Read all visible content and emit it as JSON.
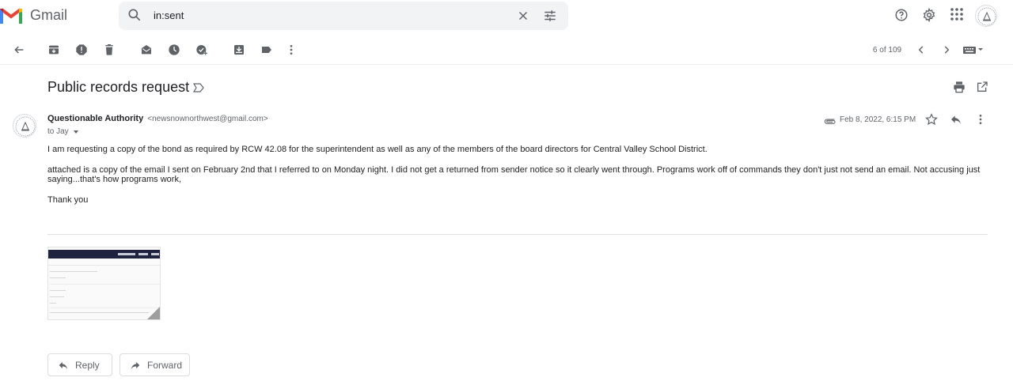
{
  "header": {
    "app_name": "Gmail",
    "search_value": "in:sent",
    "icons": [
      "gmail-logo",
      "search-icon",
      "close-icon",
      "tune-icon",
      "help-icon",
      "gear-icon",
      "apps-icon",
      "account-avatar"
    ]
  },
  "toolbar": {
    "counter": "6 of 109",
    "icons": [
      "back-arrow-icon",
      "archive-icon",
      "report-spam-icon",
      "delete-icon",
      "mark-unread-icon",
      "snooze-icon",
      "add-task-icon",
      "move-to-icon",
      "label-icon",
      "more-vert-icon",
      "prev-icon",
      "next-icon",
      "input-tools-icon"
    ]
  },
  "message": {
    "subject": "Public records request",
    "sender_name": "Questionable Authority",
    "sender_email": "<newsnownorthwest@gmail.com>",
    "to": "to Jay",
    "date": "Feb 8, 2022, 6:15 PM",
    "body": [
      "I am requesting a copy of the bond as required by RCW 42.08 for the superintendent as well as any of the members of the board directors for Central Valley School District.",
      "attached is a copy of the email I sent on February 2nd that I referred to on Monday night.  I did not get a returned from sender notice so it clearly went through.  Programs work off of commands they don't just not send an email.  Not accusing just saying...that's how programs work,",
      "Thank you"
    ]
  },
  "actions": {
    "reply_label": "Reply",
    "forward_label": "Forward"
  },
  "colors": {
    "gmail_red": "#ea4335",
    "gmail_blue": "#4285f4",
    "gmail_green": "#34a853",
    "gmail_yellow": "#fbbc04",
    "icon_gray": "#5f6368"
  }
}
